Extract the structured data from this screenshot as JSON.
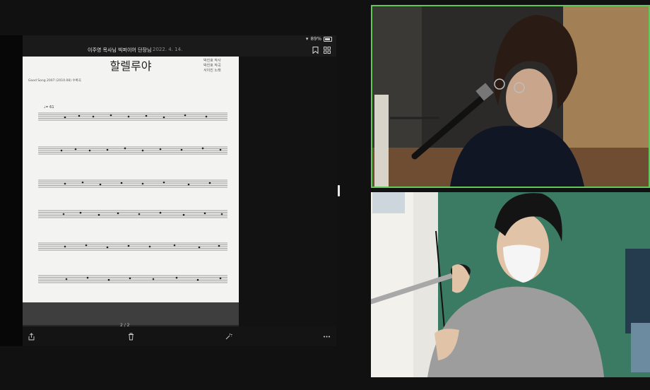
{
  "status_bar": {
    "time": "",
    "battery": "89%"
  },
  "document": {
    "title": "이주영 목사님 빅퍼이어 단장님",
    "date": "2022. 4. 14.",
    "page_indicator": "2 / 2"
  },
  "score": {
    "song_title": "할렐루야",
    "credits": [
      "박진호 작사",
      "박진호 작곡",
      "서이진 노래"
    ],
    "song_info": "Good Song 2007 (2010.08) 수록곡",
    "tempo": "♩= 61"
  },
  "colors": {
    "active_speaker_border": "#63c85a",
    "app_bg": "#111111"
  },
  "icons": [
    "bookmark-icon",
    "grid-icon",
    "share-icon",
    "trash-icon",
    "magic-icon",
    "more-icon"
  ]
}
